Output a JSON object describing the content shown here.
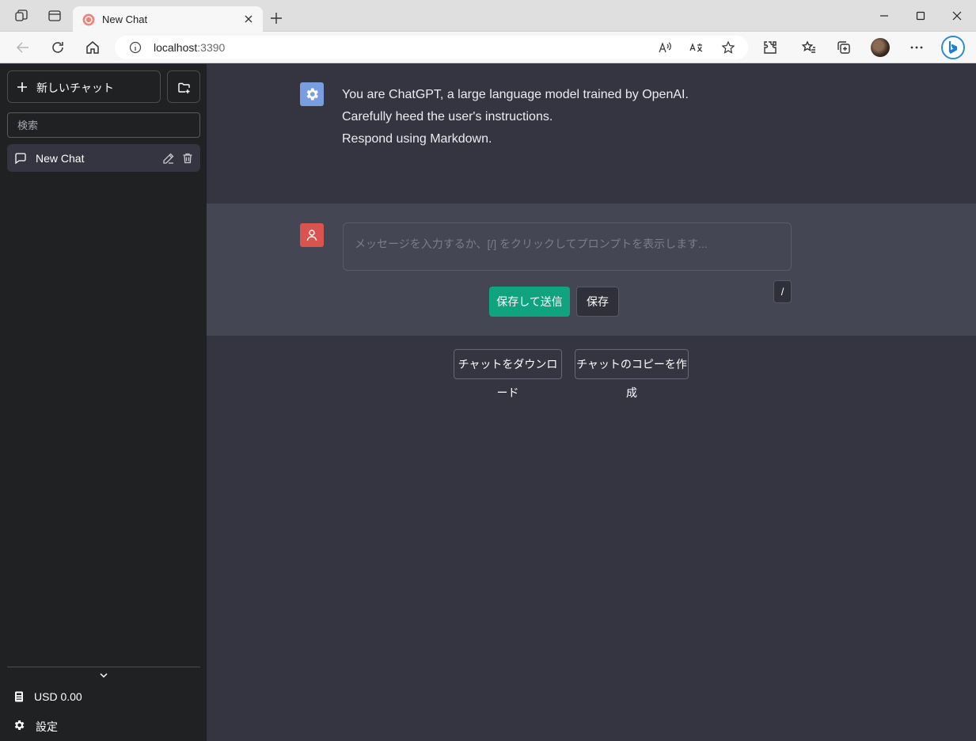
{
  "browser": {
    "tab_title": "New Chat",
    "url_host": "localhost",
    "url_port": ":3390"
  },
  "sidebar": {
    "new_chat_label": "新しいチャット",
    "search_placeholder": "検索",
    "chats": [
      {
        "label": "New Chat"
      }
    ],
    "cost_label": "USD 0.00",
    "settings_label": "設定"
  },
  "system_message": {
    "lines": [
      "You are ChatGPT, a large language model trained by OpenAI.",
      "Carefully heed the user's instructions.",
      "Respond using Markdown."
    ]
  },
  "composer": {
    "placeholder": "メッセージを入力するか、[/] をクリックしてプロンプトを表示します...",
    "save_send_label": "保存して送信",
    "save_label": "保存",
    "slash_label": "/"
  },
  "actions": {
    "download_label": "チャットをダウンロード",
    "copy_label": "チャットのコピーを作成"
  },
  "colors": {
    "sidebar_bg": "#202123",
    "main_bg": "#343541",
    "user_row_bg": "#444654",
    "accent_green": "#10a37f",
    "system_avatar": "#7a9de0",
    "user_avatar": "#d9534f"
  }
}
